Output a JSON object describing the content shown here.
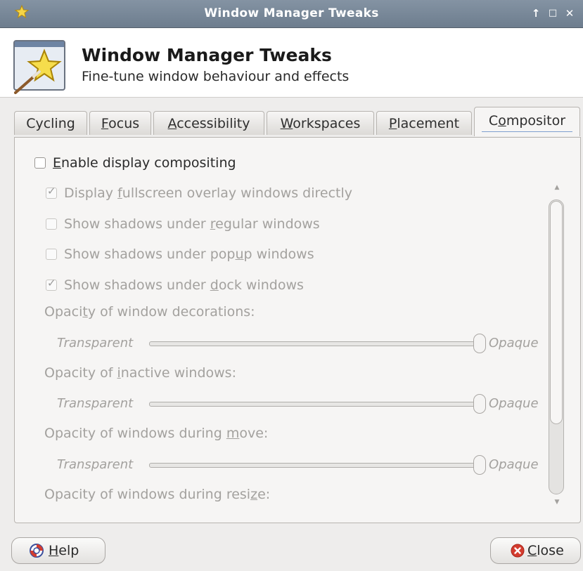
{
  "window": {
    "title": "Window Manager Tweaks",
    "controls": {
      "maximize_icon": "arrow-up-icon",
      "restore_icon": "square-icon",
      "close_icon": "close-x-icon"
    }
  },
  "header": {
    "title": "Window Manager Tweaks",
    "subtitle": "Fine-tune window behaviour and effects",
    "icon": "star-wand-icon"
  },
  "tabs": [
    {
      "label_pre": "Cycling",
      "label_ul": "",
      "label_post": ""
    },
    {
      "label_pre": "",
      "label_ul": "F",
      "label_post": "ocus"
    },
    {
      "label_pre": "",
      "label_ul": "A",
      "label_post": "ccessibility"
    },
    {
      "label_pre": "",
      "label_ul": "W",
      "label_post": "orkspaces"
    },
    {
      "label_pre": "",
      "label_ul": "P",
      "label_post": "lacement"
    },
    {
      "label_pre": "C",
      "label_ul": "o",
      "label_post": "mpositor"
    }
  ],
  "active_tab": "Compositor",
  "compositor": {
    "enable": {
      "pre": "",
      "ul": "E",
      "post": "nable display compositing",
      "checked": false
    },
    "options": [
      {
        "pre": "Display ",
        "ul": "f",
        "post": "ullscreen overlay windows directly",
        "checked": true
      },
      {
        "pre": "Show shadows under ",
        "ul": "r",
        "post": "egular windows",
        "checked": false
      },
      {
        "pre": "Show shadows under pop",
        "ul": "u",
        "post": "p windows",
        "checked": false
      },
      {
        "pre": "Show shadows under ",
        "ul": "d",
        "post": "ock windows",
        "checked": true
      }
    ],
    "opacity_sections": [
      {
        "pre": "Opaci",
        "ul": "t",
        "post": "y of window decorations:",
        "value_percent": 100
      },
      {
        "pre": "Opacity of ",
        "ul": "i",
        "post": "nactive windows:",
        "value_percent": 100
      },
      {
        "pre": "Opacity of windows during ",
        "ul": "m",
        "post": "ove:",
        "value_percent": 100
      },
      {
        "pre": "Opacity of windows during resi",
        "ul": "z",
        "post": "e:"
      }
    ],
    "slider_min_label": "Transparent",
    "slider_max_label": "Opaque"
  },
  "footer": {
    "help": {
      "ul": "H",
      "post": "elp",
      "icon": "help-lifebuoy-icon"
    },
    "close": {
      "ul": "C",
      "post": "lose",
      "icon": "close-circle-icon"
    }
  },
  "colors": {
    "titlebar": "#7787a0",
    "accent": "#7e9fcf",
    "close_icon_red": "#d43c2f"
  }
}
